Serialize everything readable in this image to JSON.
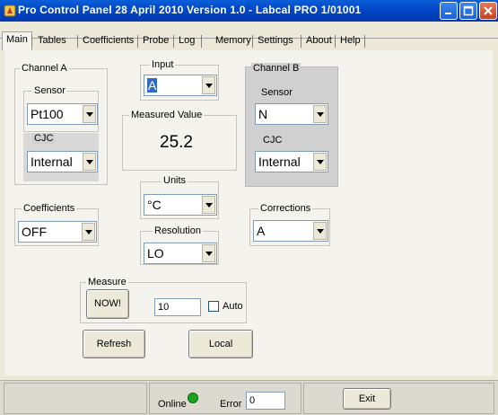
{
  "window": {
    "title": "Pro Control Panel 28 April 2010 Version 1.0 - Labcal PRO 1/01001"
  },
  "menu": {
    "tabs": [
      "Main",
      "Tables",
      "Coefficients",
      "Probe",
      "Log",
      "Memory",
      "Settings",
      "About",
      "Help"
    ],
    "active": "Main"
  },
  "channel_a": {
    "label": "Channel A",
    "sensor_label": "Sensor",
    "sensor_value": "Pt100",
    "cjc_label": "CJC",
    "cjc_value": "Internal"
  },
  "channel_b": {
    "label": "Channel B",
    "sensor_label": "Sensor",
    "sensor_value": "N",
    "cjc_label": "CJC",
    "cjc_value": "Internal"
  },
  "input": {
    "label": "Input",
    "value": "A"
  },
  "measured": {
    "label": "Measured Value",
    "value": "25.2"
  },
  "units": {
    "label": "Units",
    "value": "°C"
  },
  "resolution": {
    "label": "Resolution",
    "value": "LO"
  },
  "coefficients": {
    "label": "Coefficients",
    "value": "OFF"
  },
  "corrections": {
    "label": "Corrections",
    "value": "A"
  },
  "measure": {
    "label": "Measure",
    "now_button": "NOW!",
    "count_value": "10",
    "auto_label": "Auto",
    "auto_checked": false
  },
  "actions": {
    "refresh": "Refresh",
    "local": "Local"
  },
  "status": {
    "online_label": "Online",
    "online_color": "#1fa31f",
    "error_label": "Error",
    "error_value": "0",
    "exit_button": "Exit"
  }
}
